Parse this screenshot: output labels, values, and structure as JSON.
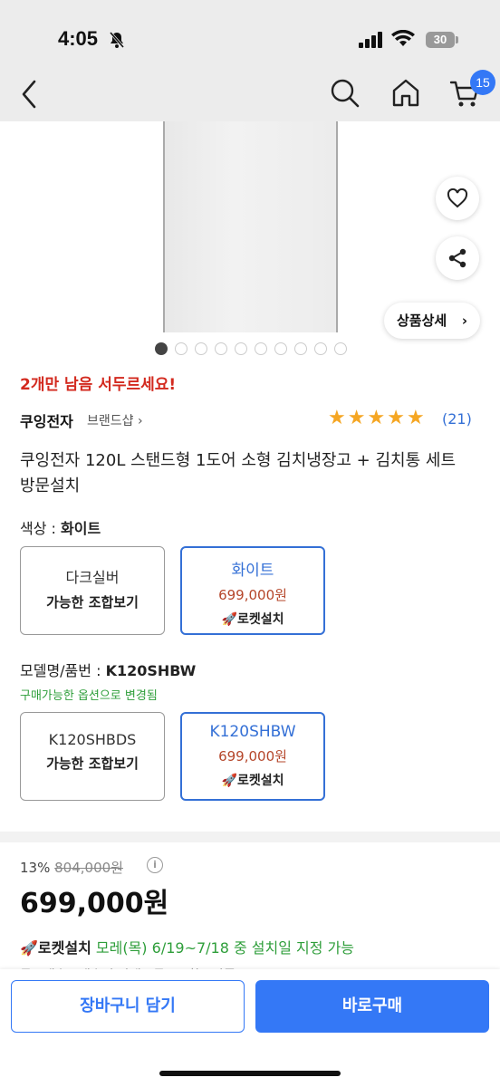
{
  "status_bar": {
    "time": "4:05",
    "battery": "30"
  },
  "nav": {
    "cart_count": "15"
  },
  "gallery": {
    "detail_label": "상품상세",
    "image_count": 10,
    "active_index": 0
  },
  "product": {
    "urgency": "2개만 남음 서두르세요!",
    "brand": "쿠잉전자",
    "brand_shop": "브랜드샵",
    "rating": 5,
    "review_count": "(21)",
    "title": "쿠잉전자 120L 스탠드형 1도어 소형 김치냉장고 + 김치통 세트 방문설치"
  },
  "color_option": {
    "label": "색상 : ",
    "selected": "화이트",
    "options": [
      {
        "name": "다크실버",
        "sub": "가능한 조합보기",
        "selected": false
      },
      {
        "name": "화이트",
        "price": "699,000원",
        "rocket": "로켓설치",
        "selected": true
      }
    ]
  },
  "model_option": {
    "label": "모델명/품번 : ",
    "selected": "K120SHBW",
    "note": "구매가능한 옵션으로 변경됨",
    "options": [
      {
        "name": "K120SHBDS",
        "sub": "가능한 조합보기",
        "selected": false
      },
      {
        "name": "K120SHBW",
        "price": "699,000원",
        "rocket": "로켓설치",
        "selected": true
      }
    ]
  },
  "pricing": {
    "discount": "13%",
    "original": "804,000원",
    "price": "699,000원"
  },
  "delivery": {
    "label": "로켓설치",
    "text": "모레(목) 6/19~7/18 중 설치일 지정 가능",
    "cut_text": "무료배송 · 배송비 안내 · 무료교환 / 반품"
  },
  "actions": {
    "cart": "장바구니 담기",
    "buy": "바로구매"
  },
  "colors": {
    "accent": "#3478f6",
    "urgent": "#d32a1f",
    "green": "#2e9e3a",
    "star": "#f5a623"
  }
}
